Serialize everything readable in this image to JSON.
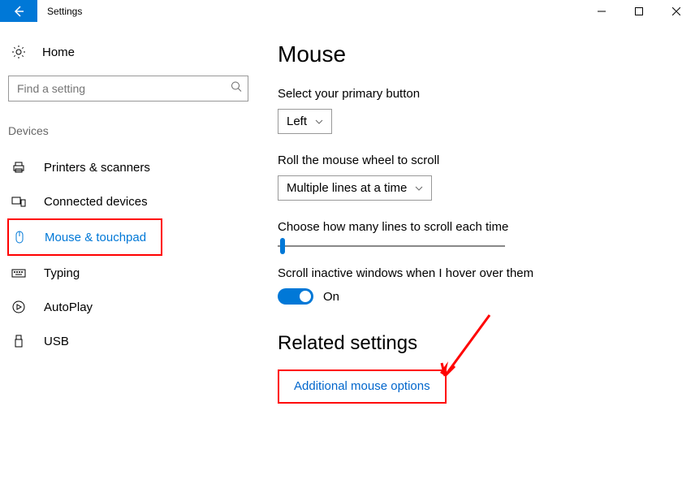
{
  "window": {
    "title": "Settings"
  },
  "sidebar": {
    "home": "Home",
    "search_placeholder": "Find a setting",
    "section": "Devices",
    "items": [
      {
        "label": "Printers & scanners"
      },
      {
        "label": "Connected devices"
      },
      {
        "label": "Mouse & touchpad"
      },
      {
        "label": "Typing"
      },
      {
        "label": "AutoPlay"
      },
      {
        "label": "USB"
      }
    ]
  },
  "main": {
    "title": "Mouse",
    "primary_button": {
      "label": "Select your primary button",
      "value": "Left"
    },
    "wheel_scroll": {
      "label": "Roll the mouse wheel to scroll",
      "value": "Multiple lines at a time"
    },
    "lines_scroll": {
      "label": "Choose how many lines to scroll each time"
    },
    "hover_scroll": {
      "label": "Scroll inactive windows when I hover over them",
      "state": "On"
    },
    "related_heading": "Related settings",
    "related_link": "Additional mouse options"
  }
}
